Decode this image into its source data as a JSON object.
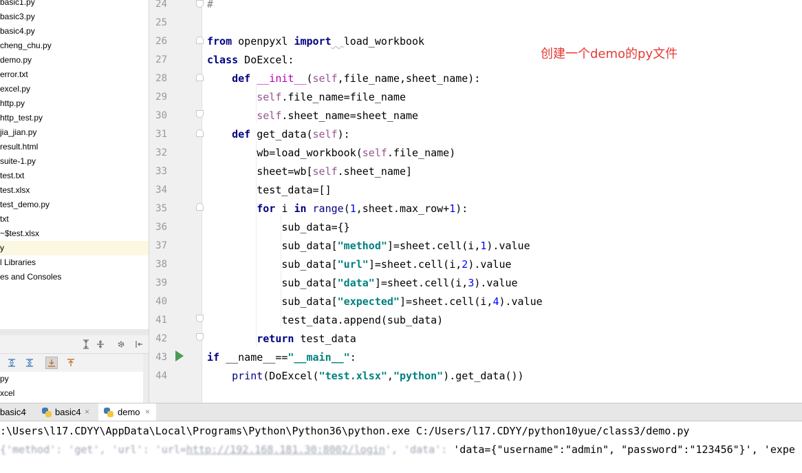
{
  "project_tree": {
    "items": [
      {
        "label": "basic1.py"
      },
      {
        "label": "basic3.py"
      },
      {
        "label": "basic4.py"
      },
      {
        "label": "cheng_chu.py"
      },
      {
        "label": "demo.py"
      },
      {
        "label": "error.txt"
      },
      {
        "label": "excel.py"
      },
      {
        "label": "http.py"
      },
      {
        "label": "http_test.py"
      },
      {
        "label": "jia_jian.py"
      },
      {
        "label": "result.html"
      },
      {
        "label": "suite-1.py"
      },
      {
        "label": "test.txt"
      },
      {
        "label": "test.xlsx"
      },
      {
        "label": "test_demo.py"
      },
      {
        "label": "txt"
      },
      {
        "label": "~$test.xlsx"
      },
      {
        "label": "y",
        "selected": true
      },
      {
        "label": "l Libraries"
      },
      {
        "label": "es and Consoles"
      }
    ]
  },
  "structure_panel": {
    "items": [
      {
        "label": "py"
      },
      {
        "label": "xcel"
      }
    ]
  },
  "editor": {
    "line_numbers": [
      "24",
      "25",
      "26",
      "27",
      "28",
      "29",
      "30",
      "31",
      "32",
      "33",
      "34",
      "35",
      "36",
      "37",
      "38",
      "39",
      "40",
      "41",
      "42",
      "43",
      "44"
    ],
    "annotation": "创建一个demo的py文件"
  },
  "run_tabs": [
    {
      "label": "basic4",
      "close": "×",
      "active": false
    },
    {
      "label": "basic4",
      "close": "×",
      "active": false
    },
    {
      "label": "demo",
      "close": "×",
      "active": true
    }
  ],
  "console": {
    "command_line": ":\\Users\\l17.CDYY\\AppData\\Local\\Programs\\Python\\Python36\\python.exe C:/Users/l17.CDYY/python10yue/class3/demo.py",
    "output_prefix": "{'method': 'get', 'url': 'url=",
    "output_link": "http://192.168.181.30:8002/login",
    "output_middle": "', 'data': ",
    "output_suffix": "'data={\"username\":\"admin\", \"password\":\"123456\"}', 'expe"
  },
  "colors": {
    "keyword": "#000080",
    "self": "#94558d",
    "number": "#0000ff",
    "string": "#008080",
    "annotation": "#e53935",
    "link": "#2a53c4"
  }
}
